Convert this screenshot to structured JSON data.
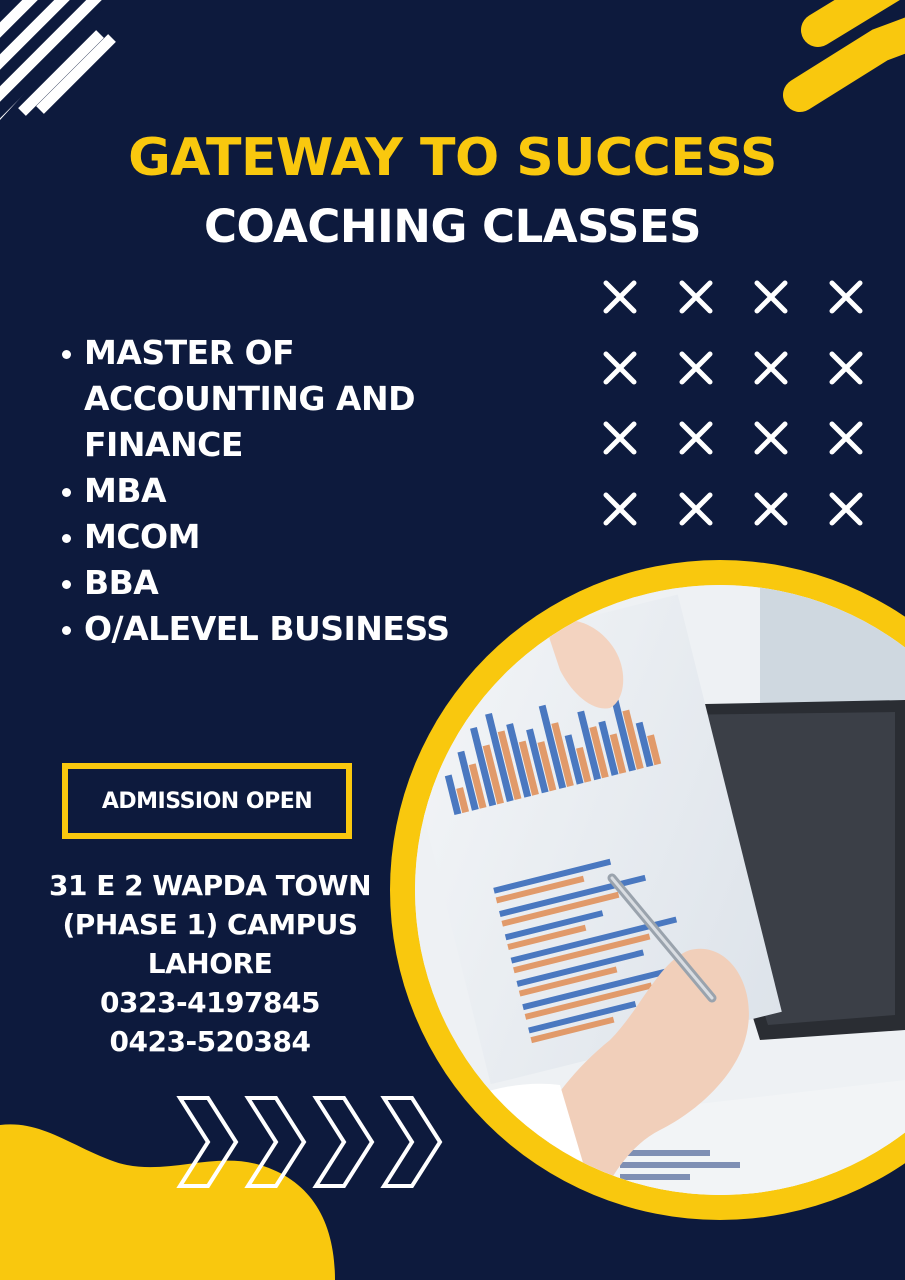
{
  "heading": {
    "title": "GATEWAY TO SUCCESS",
    "subtitle": "COACHING CLASSES"
  },
  "courses": [
    "MASTER OF ACCOUNTING AND FINANCE",
    "MBA",
    "MCOM",
    "BBA",
    "O/ALEVEL BUSINESS"
  ],
  "admission": {
    "label": "ADMISSION OPEN"
  },
  "contact": {
    "address_line1": "31 E 2 WAPDA TOWN",
    "address_line2": "(PHASE 1) CAMPUS",
    "city": "LAHORE",
    "phone1": "0323-4197845",
    "phone2": "0423-520384"
  },
  "colors": {
    "background": "#0d1a3d",
    "accent": "#f9c80e",
    "text": "#ffffff"
  },
  "icons": [
    "diagonal-stripes-icon",
    "arrow-stripes-icon",
    "x-pattern-icon",
    "chevron-right-icon"
  ]
}
